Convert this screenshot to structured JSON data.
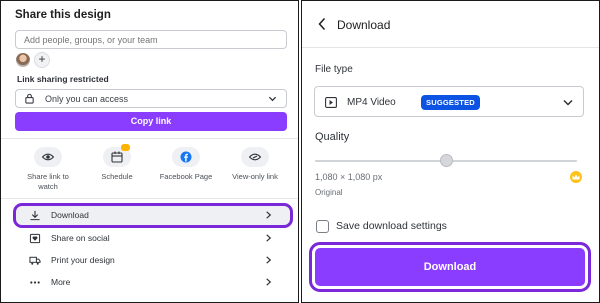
{
  "share": {
    "title": "Share this design",
    "people_placeholder": "Add people, groups, or your team",
    "add_symbol": "+",
    "link_label": "Link sharing restricted",
    "access_value": "Only you can access",
    "copy_link_label": "Copy link",
    "quick_actions": [
      {
        "label": "Share link to watch",
        "icon": "eye-icon"
      },
      {
        "label": "Schedule",
        "icon": "calendar-icon"
      },
      {
        "label": "Facebook Page",
        "icon": "facebook-icon"
      },
      {
        "label": "View-only link",
        "icon": "link-icon"
      }
    ],
    "menu": [
      {
        "label": "Download",
        "icon": "download-icon"
      },
      {
        "label": "Share on social",
        "icon": "heart-icon"
      },
      {
        "label": "Print your design",
        "icon": "truck-icon"
      },
      {
        "label": "More",
        "icon": "ellipsis-icon"
      }
    ]
  },
  "download": {
    "title": "Download",
    "file_type_label": "File type",
    "file_type_value": "MP4 Video",
    "suggested_badge": "SUGGESTED",
    "quality_label": "Quality",
    "quality_level": 0.5,
    "resolution": "1,080 × 1,080 px",
    "original_label": "Original",
    "save_settings_label": "Save download settings",
    "save_settings_checked": false,
    "button_label": "Download"
  },
  "colors": {
    "accent": "#8b3dff",
    "highlight": "#7a28d8",
    "badge": "#0c53e3",
    "premium": "#ffc21a"
  }
}
